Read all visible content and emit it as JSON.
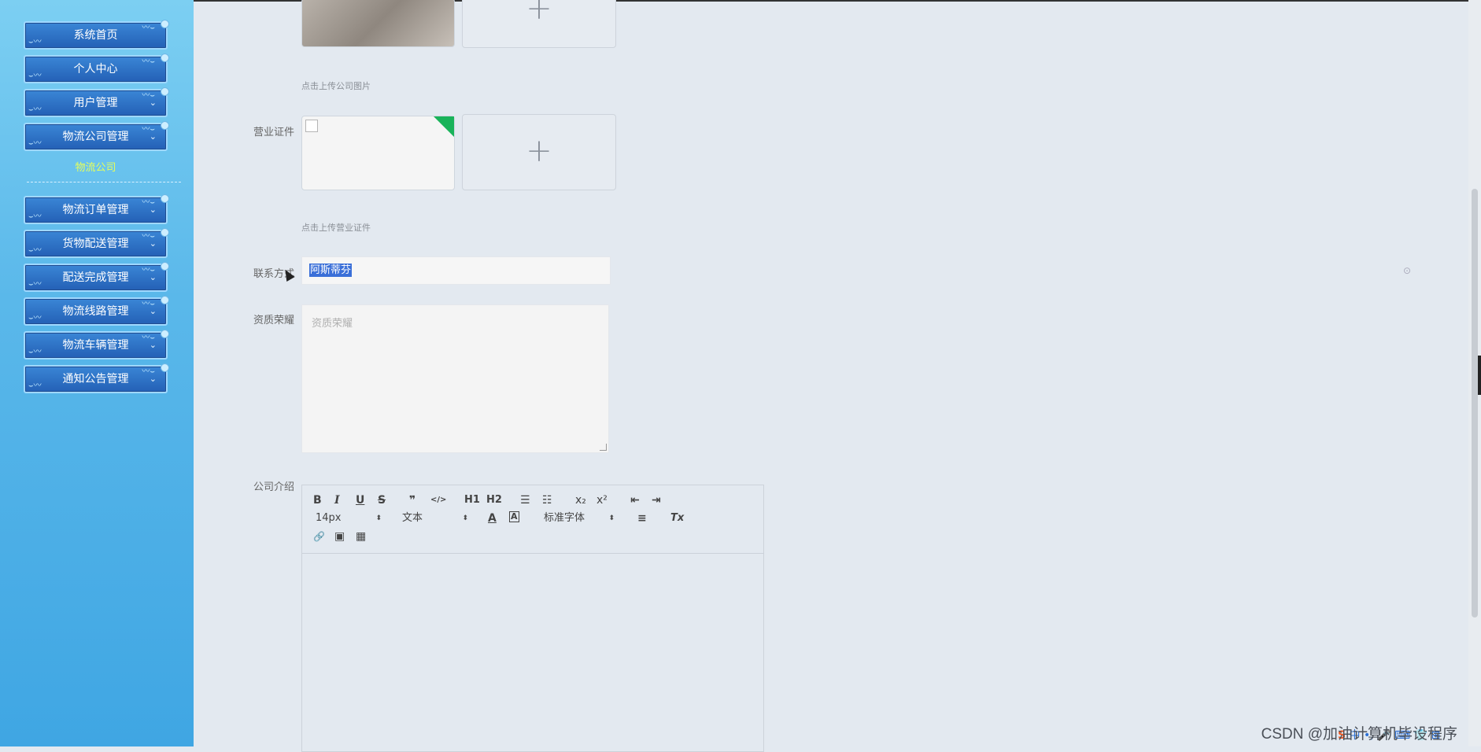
{
  "sidebar": {
    "items": [
      {
        "label": "系统首页"
      },
      {
        "label": "个人中心"
      },
      {
        "label": "用户管理"
      },
      {
        "label": "物流公司管理"
      },
      {
        "label": "物流订单管理"
      },
      {
        "label": "货物配送管理"
      },
      {
        "label": "配送完成管理"
      },
      {
        "label": "物流线路管理"
      },
      {
        "label": "物流车辆管理"
      },
      {
        "label": "通知公告管理"
      }
    ],
    "sub_item": "物流公司"
  },
  "form": {
    "company_image_hint": "点击上传公司图片",
    "license_label": "营业证件",
    "license_hint": "点击上传营业证件",
    "contact_label": "联系方式",
    "contact_value": "阿斯蒂芬",
    "honor_label": "资质荣耀",
    "honor_placeholder": "资质荣耀",
    "intro_label": "公司介绍",
    "plus": "+"
  },
  "editor": {
    "buttons": {
      "bold": "B",
      "italic": "I",
      "underline": "U",
      "strike": "S",
      "quote": "❞",
      "code": "</>",
      "h1": "H1",
      "h2": "H2",
      "ordered": "☰",
      "bullet": "☷",
      "sub": "x₂",
      "sup": "x²",
      "outdent": "⇤",
      "indent": "⇥",
      "color": "A",
      "bg": "A",
      "align": "≡",
      "clean": "Tx",
      "link": "🔗",
      "image": "▣",
      "video": "▦"
    },
    "size_select": "14px",
    "header_select": "文本",
    "font_select": "标准字体"
  },
  "watermark": "CSDN @加油计算机毕设程序",
  "tray": {
    "s": "S",
    "zh": "中"
  }
}
